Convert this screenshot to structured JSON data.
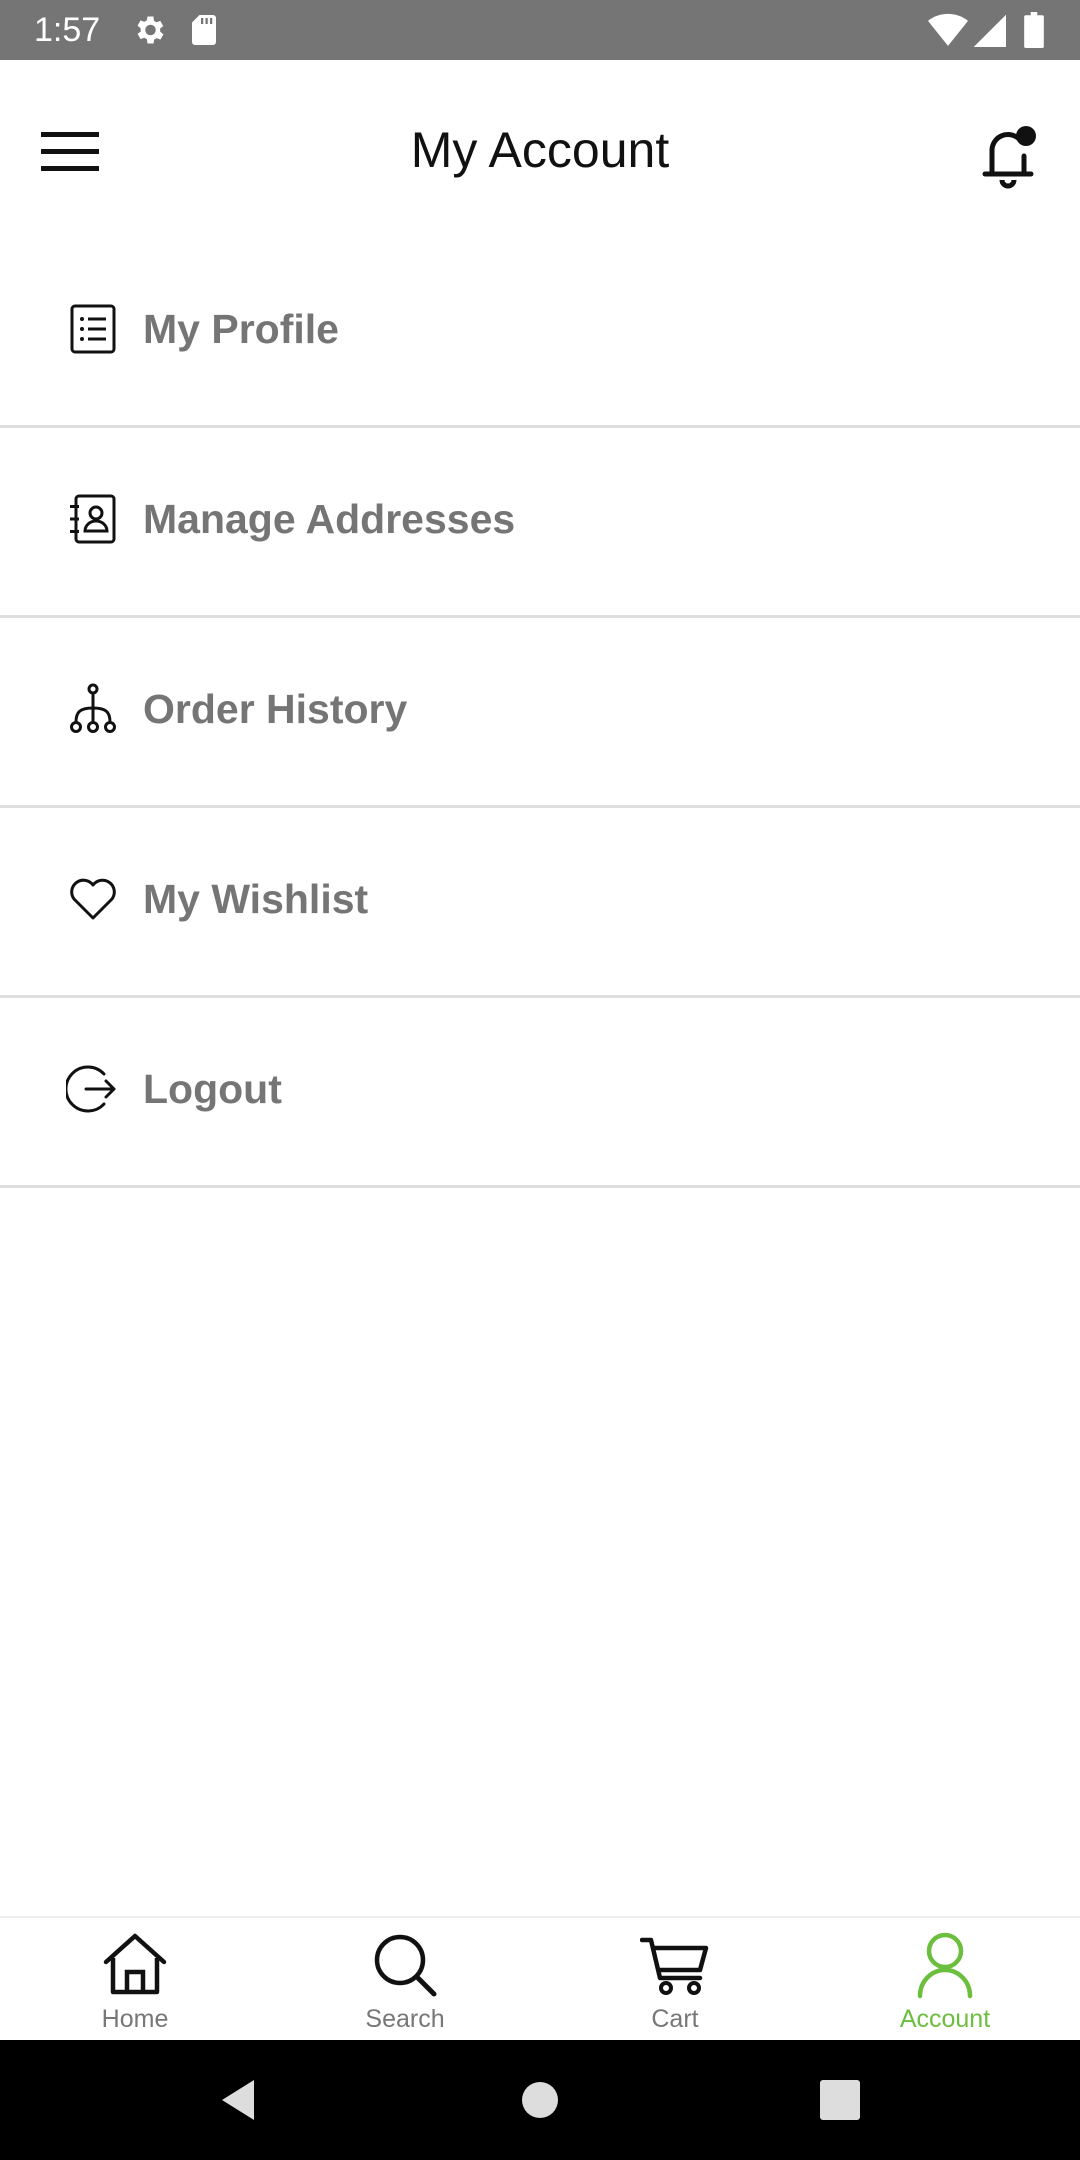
{
  "status_bar": {
    "time": "1:57",
    "left_icons": [
      "gear-icon",
      "sd-card-icon"
    ],
    "right_icons": [
      "wifi-icon",
      "cell-signal-icon",
      "battery-icon"
    ],
    "background_color": "#757575"
  },
  "app_bar": {
    "title": "My Account",
    "menu_icon": "hamburger-menu-icon",
    "notification_icon": "notification-bell-icon"
  },
  "menu": {
    "items": [
      {
        "label": "My Profile",
        "icon": "profile-list-icon"
      },
      {
        "label": "Manage Addresses",
        "icon": "address-book-icon"
      },
      {
        "label": "Order History",
        "icon": "order-tree-icon"
      },
      {
        "label": "My Wishlist",
        "icon": "heart-icon"
      },
      {
        "label": "Logout",
        "icon": "logout-icon"
      }
    ],
    "label_color": "#757575",
    "divider_color": "#dedede"
  },
  "bottom_nav": {
    "tabs": [
      {
        "label": "Home",
        "icon": "home-icon",
        "active": false
      },
      {
        "label": "Search",
        "icon": "search-icon",
        "active": false
      },
      {
        "label": "Cart",
        "icon": "cart-icon",
        "active": false
      },
      {
        "label": "Account",
        "icon": "account-icon",
        "active": true
      }
    ],
    "active_color": "#6cbf3e",
    "inactive_color": "#777777"
  },
  "system_nav": {
    "buttons": [
      "back-icon",
      "home-circle-icon",
      "recents-icon"
    ]
  }
}
